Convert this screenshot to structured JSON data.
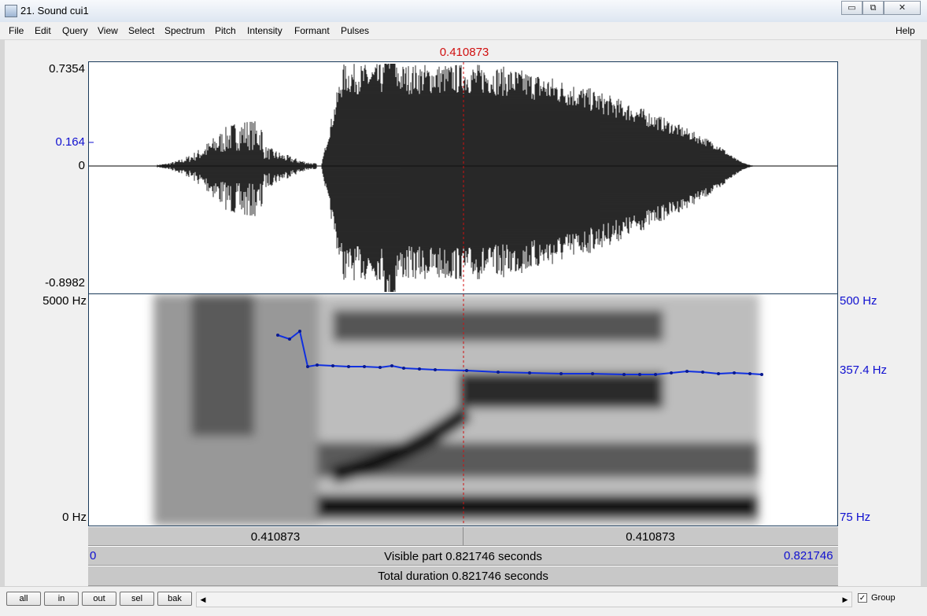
{
  "window": {
    "title": "21. Sound cui1",
    "controls": {
      "minimize": "▭",
      "maximize": "⧉",
      "close": "✕"
    }
  },
  "menu": [
    {
      "label": "File"
    },
    {
      "label": "Edit"
    },
    {
      "label": "Query"
    },
    {
      "label": "View"
    },
    {
      "label": "Select"
    },
    {
      "label": "Spectrum"
    },
    {
      "label": "Pitch"
    },
    {
      "label": "Intensity"
    },
    {
      "label": "Formant"
    },
    {
      "label": "Pulses"
    }
  ],
  "help_label": "Help",
  "cursor_time": "0.410873",
  "waveform": {
    "max_label": "0.7354",
    "cursor_value_label": "0.164",
    "zero_label": "0",
    "min_label": "-0.8982"
  },
  "spectrogram": {
    "freq_top_label": "5000 Hz",
    "freq_bottom_label": "0 Hz",
    "pitch_top_label": "500 Hz",
    "pitch_cursor_label": "357.4 Hz",
    "pitch_bottom_label": "75 Hz"
  },
  "time_bars": {
    "left_part": "0.410873",
    "right_part": "0.410873",
    "visible_start": "0",
    "visible_label": "Visible part 0.821746 seconds",
    "visible_end": "0.821746",
    "total_label": "Total duration 0.821746 seconds"
  },
  "buttons": [
    {
      "label": "all"
    },
    {
      "label": "in"
    },
    {
      "label": "out"
    },
    {
      "label": "sel"
    },
    {
      "label": "bak"
    }
  ],
  "group_checkbox": {
    "label": "Group",
    "checked": true
  },
  "colors": {
    "cursor": "#d01010",
    "pitch": "#1030e0",
    "axis_blue": "#1010d0"
  }
}
